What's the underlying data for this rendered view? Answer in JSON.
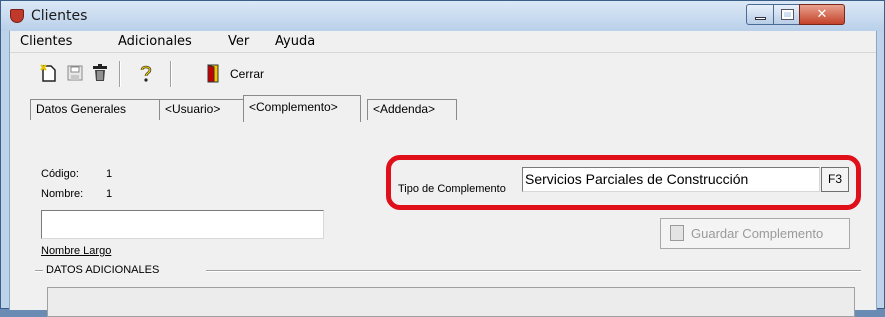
{
  "window": {
    "title": "Clientes"
  },
  "menu": [
    "Clientes",
    "Adicionales",
    "Ver",
    "Ayuda"
  ],
  "toolbar": {
    "icons": [
      "new-document-icon",
      "save-icon",
      "delete-icon",
      "help-icon",
      "exit-door-icon"
    ],
    "close_label": "Cerrar"
  },
  "tabs": [
    "Datos Generales",
    "<Usuario>",
    "<Complemento>",
    "<Addenda>"
  ],
  "active_tab": "<Complemento>",
  "fields": {
    "codigo_label": "Código:",
    "codigo_value": "1",
    "nombre_label": "Nombre:",
    "nombre_value": "1",
    "nombre_largo_label": "Nombre Largo",
    "nombre_largo_value": "",
    "tipo_label": "Tipo de Complemento",
    "tipo_value": "Servicios Parciales de Construcción",
    "f3_label": "F3"
  },
  "buttons": {
    "guardar": "Guardar Complemento"
  },
  "section": {
    "datos_adicionales": "DATOS ADICIONALES"
  },
  "colors": {
    "highlight": "#e0101a",
    "close_button": "#c4432a"
  }
}
